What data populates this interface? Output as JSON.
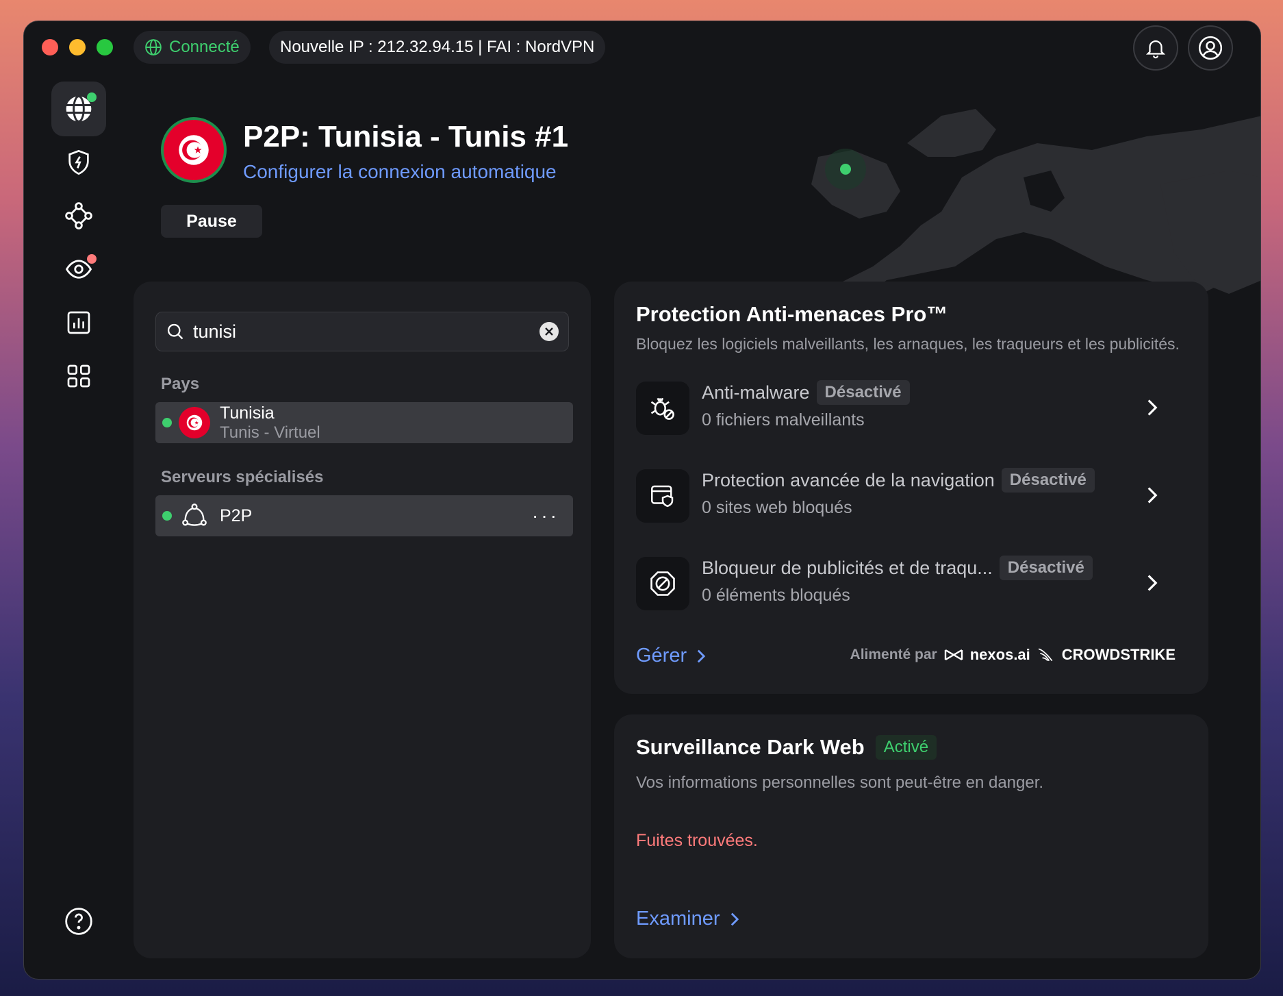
{
  "titlebar": {
    "status": "Connecté",
    "ip_info": "Nouvelle IP : 212.32.94.15 | FAI : NordVPN"
  },
  "header": {
    "server_name": "P2P: Tunisia - Tunis #1",
    "auto_connect_link": "Configurer la connexion automatique",
    "pause_label": "Pause"
  },
  "search": {
    "value": "tunisi",
    "country_section": "Pays",
    "specialty_section": "Serveurs spécialisés",
    "country_result": {
      "name": "Tunisia",
      "sub": "Tunis - Virtuel"
    },
    "specialty_result": {
      "name": "P2P",
      "menu": "···"
    }
  },
  "threat": {
    "title": "Protection Anti-menaces Pro™",
    "subtitle": "Bloquez les logiciels malveillants, les arnaques, les traqueurs et les publicités.",
    "features": [
      {
        "name": "Anti-malware",
        "status": "Désactivé",
        "sub": "0 fichiers malveillants"
      },
      {
        "name": "Protection avancée de la navigation",
        "status": "Désactivé",
        "sub": "0 sites web bloqués"
      },
      {
        "name": "Bloqueur de publicités et de traqu...",
        "status": "Désactivé",
        "sub": "0 éléments bloqués"
      }
    ],
    "manage_link": "Gérer",
    "powered_by": "Alimenté par",
    "brand_1": "nexos.ai",
    "brand_2": "CROWDSTRIKE"
  },
  "darkweb": {
    "title": "Surveillance Dark Web",
    "status": "Activé",
    "subtitle": "Vos informations personnelles sont peut-être en danger.",
    "leak": "Fuites trouvées.",
    "examine_link": "Examiner"
  },
  "colors": {
    "accent_blue": "#6f9bff",
    "connected_green": "#3ecf6e",
    "alert_red": "#ff7b7b",
    "flag_red": "#e4002b"
  }
}
